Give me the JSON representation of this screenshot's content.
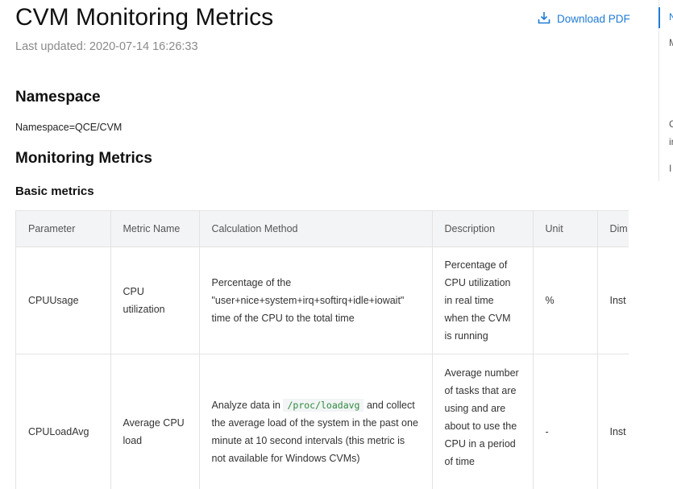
{
  "header": {
    "title": "CVM Monitoring Metrics",
    "last_updated": "Last updated: 2020-07-14 16:26:33",
    "download_label": "Download PDF",
    "download_icon": "download-icon",
    "accent_color": "#1f7bd6"
  },
  "sections": {
    "namespace_heading": "Namespace",
    "namespace_text": "Namespace=QCE/CVM",
    "metrics_heading": "Monitoring Metrics",
    "basic_heading": "Basic metrics"
  },
  "table": {
    "headers": [
      "Parameter",
      "Metric Name",
      "Calculation Method",
      "Description",
      "Unit",
      "Dim"
    ],
    "rows": [
      {
        "parameter": "CPUUsage",
        "metric_name": "CPU utilization",
        "calculation": "Percentage of the \"user+nice+system+irq+softirq+idle+iowait\" time of the CPU to the total time",
        "description": "Percentage of CPU utilization in real time when the CVM is running",
        "unit": "%",
        "dim": "Inst"
      },
      {
        "parameter": "CPULoadAvg",
        "metric_name": "Average CPU load",
        "calc_before": "Analyze data in",
        "calc_code": "/proc/loadavg",
        "calc_after": "and collect the average load of the system in the past one minute at 10 second intervals (this metric is not available for Windows CVMs)",
        "description": "Average number of tasks that are using and are about to use the CPU in a period of time",
        "unit": "-",
        "dim": "Inst"
      }
    ]
  },
  "side_nav": {
    "items": [
      "N",
      "M",
      "C",
      "ir",
      "I"
    ]
  }
}
